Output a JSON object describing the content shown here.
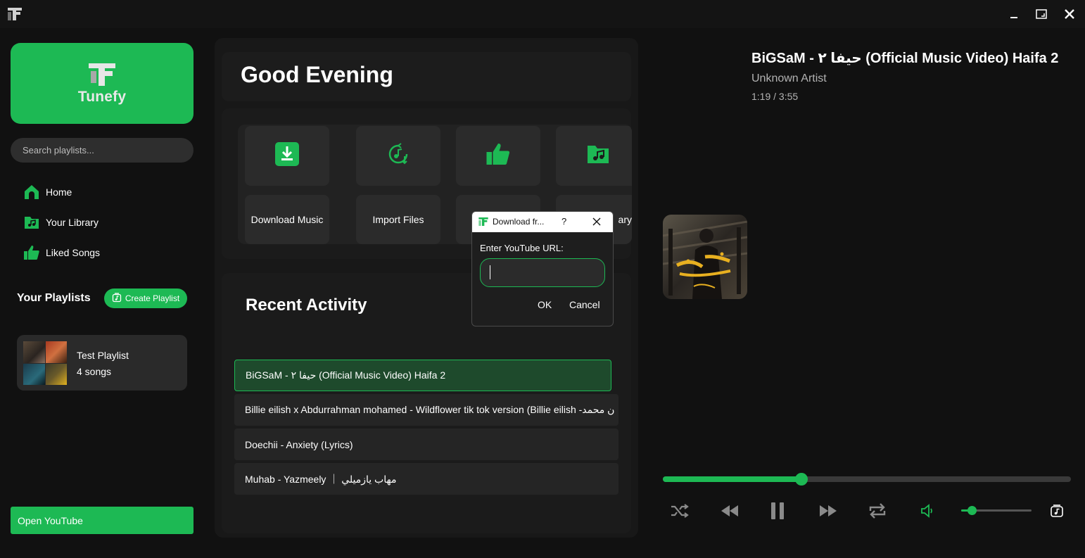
{
  "app": {
    "name": "Tunefy",
    "accent": "#1db954"
  },
  "titlebar": {
    "icons": [
      "app-logo-icon",
      "minimize-icon",
      "maximize-icon",
      "close-icon"
    ]
  },
  "sidebar": {
    "search_placeholder": "Search playlists...",
    "nav": [
      {
        "label": "Home",
        "icon": "home-icon"
      },
      {
        "label": "Your Library",
        "icon": "library-icon"
      },
      {
        "label": "Liked Songs",
        "icon": "thumbs-up-icon"
      }
    ],
    "playlists_heading": "Your Playlists",
    "create_playlist_label": "Create Playlist",
    "playlists": [
      {
        "name": "Test Playlist",
        "count": "4 songs"
      }
    ],
    "open_youtube_label": "Open YouTube"
  },
  "main": {
    "greeting": "Good Evening",
    "quick_actions": [
      {
        "label": "Download Music",
        "icon": "download-icon"
      },
      {
        "label": "Import Files",
        "icon": "import-icon"
      },
      {
        "label": "",
        "icon": "thumbs-up-icon"
      },
      {
        "label": "ary",
        "icon": "music-folder-icon"
      }
    ],
    "recent_activity_title": "Recent Activity",
    "recent_tracks": [
      "BiGSaM - حيفا ٢ (Official Music Video) Haifa 2",
      "Billie eilish x Abdurrahman mohamed - Wildflower tik tok version (Billie eilish -ن محمد",
      "Doechii - Anxiety (Lyrics)",
      "Muhab - Yazmeely ｜ مهاب يازميلي"
    ]
  },
  "dialog": {
    "title": "Download fr...",
    "help": "?",
    "label": "Enter YouTube URL:",
    "url_value": "",
    "ok": "OK",
    "cancel": "Cancel"
  },
  "now_playing": {
    "title": "BiGSaM - حيفا ٢ (Official Music Video) Haifa 2",
    "artist": "Unknown Artist",
    "time": "1:19 / 3:55",
    "progress": 0.34,
    "volume": 0.15,
    "controls": [
      "shuffle-icon",
      "previous-icon",
      "pause-icon",
      "next-icon",
      "repeat-icon",
      "volume-icon",
      "add-to-playlist-icon"
    ]
  }
}
